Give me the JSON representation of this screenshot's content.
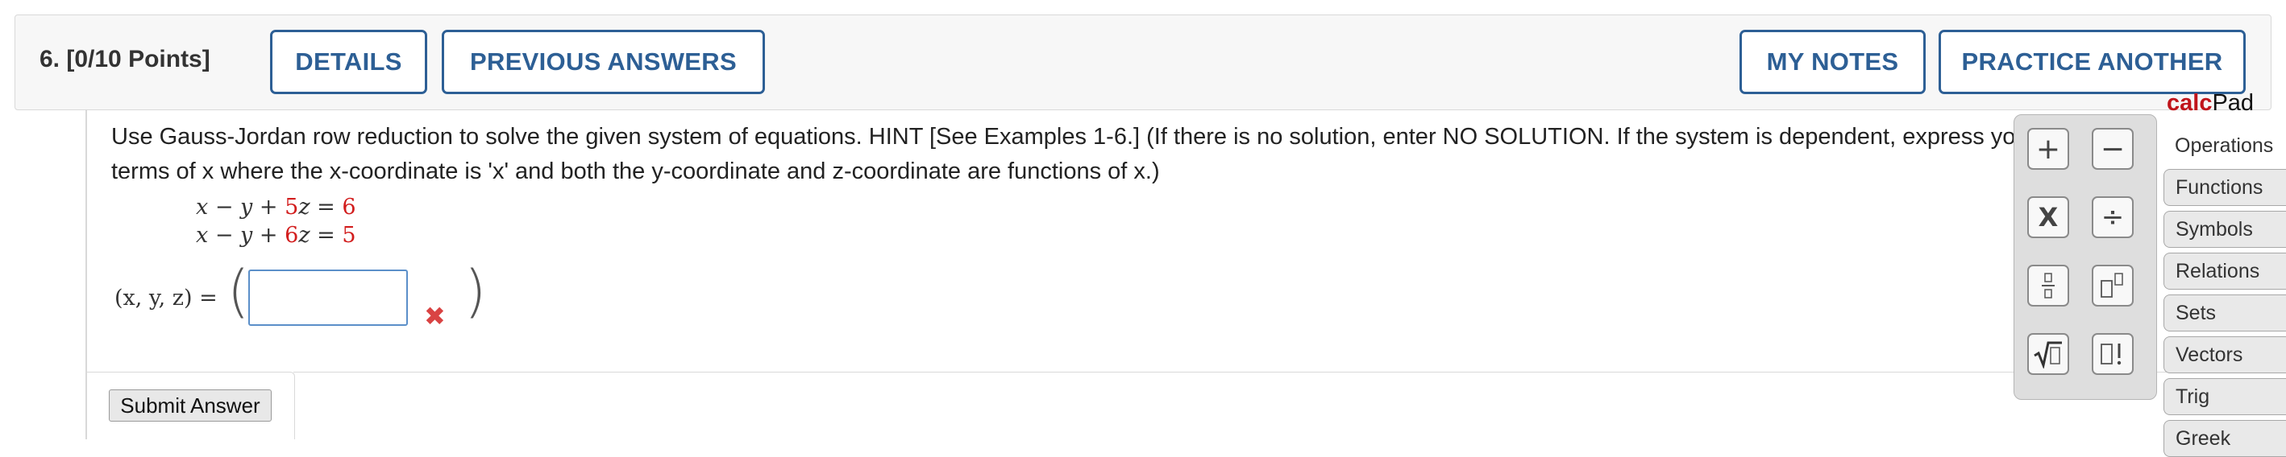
{
  "header": {
    "question": "6.  [0/10 Points]",
    "buttons": {
      "details": "DETAILS",
      "previous_answers": "PREVIOUS ANSWERS",
      "my_notes": "MY NOTES",
      "practice_another": "PRACTICE ANOTHER"
    }
  },
  "question": {
    "prompt_line1": "Use Gauss-Jordan row reduction to solve the given system of equations. HINT [See Examples 1-6.] (If there is no solution, enter NO SOLUTION. If the system is dependent, express your answer in",
    "prompt_line2": "terms of x where the x-coordinate is 'x' and both the y-coordinate and z-coordinate are functions of x.)",
    "equations": [
      {
        "x": "x",
        "op1": "−",
        "y": "y",
        "op2": "+",
        "coef": "5",
        "z": "z",
        "eq": "=",
        "rhs": "6"
      },
      {
        "x": "x",
        "op1": "−",
        "y": "y",
        "op2": "+",
        "coef": "6",
        "z": "z",
        "eq": "=",
        "rhs": "5"
      }
    ],
    "answer_label": "(x, y, z) =",
    "answer_value": "",
    "submit_label": "Submit Answer",
    "status_colors": {
      "incorrect": "#d94343",
      "coefficients": "#d21d1d",
      "accent": "#2d5f95"
    }
  },
  "calcpad": {
    "title_calc": "calc",
    "title_pad": "Pad",
    "keys": [
      {
        "name": "plus",
        "symbol": "+"
      },
      {
        "name": "minus",
        "symbol": "−"
      },
      {
        "name": "times",
        "symbol": "X"
      },
      {
        "name": "divide",
        "symbol": "÷"
      },
      {
        "name": "fraction",
        "symbol": "▯/▯"
      },
      {
        "name": "exponent",
        "symbol": "▯▯"
      },
      {
        "name": "square-root",
        "symbol": "√▯"
      },
      {
        "name": "factorial",
        "symbol": "▯!"
      }
    ],
    "tabs": [
      "Operations",
      "Functions",
      "Symbols",
      "Relations",
      "Sets",
      "Vectors",
      "Trig",
      "Greek"
    ]
  }
}
